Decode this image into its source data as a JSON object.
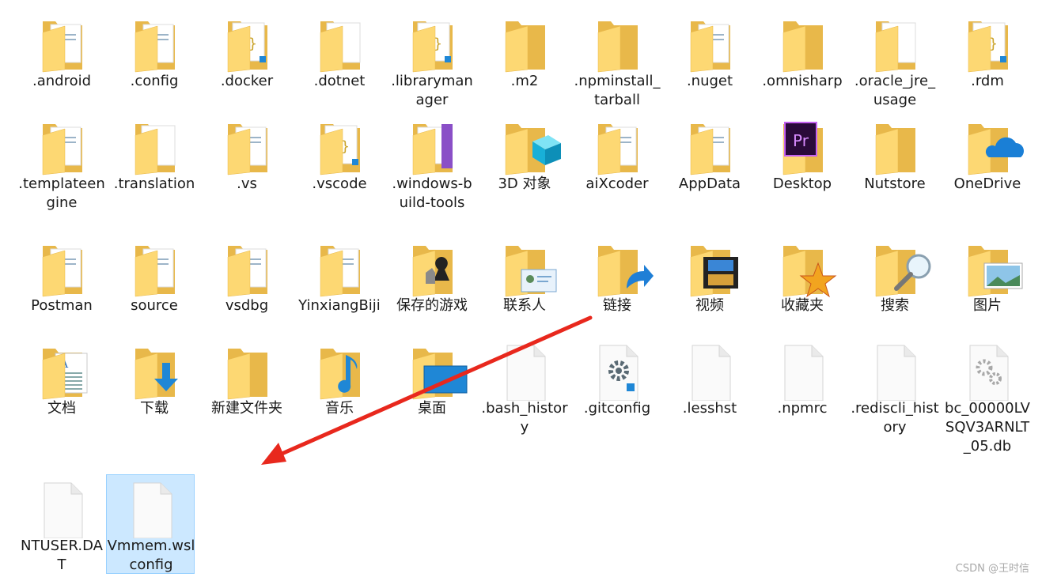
{
  "items": [
    {
      "label": ".android",
      "icon": "folder-android-icon",
      "kind": "folder",
      "overlay": "android"
    },
    {
      "label": ".config",
      "icon": "folder-icon",
      "kind": "folder",
      "overlay": "docs"
    },
    {
      "label": ".docker",
      "icon": "folder-json-icon",
      "kind": "folder",
      "overlay": "json"
    },
    {
      "label": ".dotnet",
      "icon": "folder-icon",
      "kind": "folder",
      "overlay": "blank"
    },
    {
      "label": ".librarymanager",
      "icon": "folder-json-icon",
      "kind": "folder",
      "overlay": "json"
    },
    {
      "label": ".m2",
      "icon": "folder-icon",
      "kind": "folder",
      "overlay": "none"
    },
    {
      "label": ".npminstall_tarball",
      "icon": "folder-icon",
      "kind": "folder",
      "overlay": "none"
    },
    {
      "label": ".nuget",
      "icon": "folder-icon",
      "kind": "folder",
      "overlay": "docs"
    },
    {
      "label": ".omnisharp",
      "icon": "folder-icon",
      "kind": "folder",
      "overlay": "none"
    },
    {
      "label": ".oracle_jre_usage",
      "icon": "folder-icon",
      "kind": "folder",
      "overlay": "blank"
    },
    {
      "label": ".rdm",
      "icon": "folder-json-icon",
      "kind": "folder",
      "overlay": "json"
    },
    {
      "label": ".templateengine",
      "icon": "folder-icon",
      "kind": "folder",
      "overlay": "docs"
    },
    {
      "label": ".translation",
      "icon": "folder-icon",
      "kind": "folder",
      "overlay": "blank"
    },
    {
      "label": ".vs",
      "icon": "folder-icon",
      "kind": "folder",
      "overlay": "docs"
    },
    {
      "label": ".vscode",
      "icon": "folder-json-icon",
      "kind": "folder",
      "overlay": "json"
    },
    {
      "label": ".windows-build-tools",
      "icon": "folder-vs-icon",
      "kind": "folder",
      "overlay": "vs"
    },
    {
      "label": "3D 对象",
      "icon": "folder-3d-objects-icon",
      "kind": "folder",
      "overlay": "cube"
    },
    {
      "label": "aiXcoder",
      "icon": "folder-icon",
      "kind": "folder",
      "overlay": "docs"
    },
    {
      "label": "AppData",
      "icon": "folder-icon",
      "kind": "folder",
      "overlay": "docs"
    },
    {
      "label": "Desktop",
      "icon": "folder-premiere-icon",
      "kind": "folder",
      "overlay": "pr"
    },
    {
      "label": "Nutstore",
      "icon": "folder-icon",
      "kind": "folder",
      "overlay": "none"
    },
    {
      "label": "OneDrive",
      "icon": "folder-onedrive-icon",
      "kind": "folder",
      "overlay": "cloud"
    },
    {
      "label": "Postman",
      "icon": "folder-icon",
      "kind": "folder",
      "overlay": "docs"
    },
    {
      "label": "source",
      "icon": "folder-icon",
      "kind": "folder",
      "overlay": "docs"
    },
    {
      "label": "vsdbg",
      "icon": "folder-icon",
      "kind": "folder",
      "overlay": "docs"
    },
    {
      "label": "YinxiangBiji",
      "icon": "folder-icon",
      "kind": "folder",
      "overlay": "docs"
    },
    {
      "label": "保存的游戏",
      "icon": "folder-saved-games-icon",
      "kind": "folder",
      "overlay": "chess"
    },
    {
      "label": "联系人",
      "icon": "folder-contacts-icon",
      "kind": "folder",
      "overlay": "contact"
    },
    {
      "label": "链接",
      "icon": "folder-links-icon",
      "kind": "folder",
      "overlay": "link"
    },
    {
      "label": "视频",
      "icon": "folder-videos-icon",
      "kind": "folder",
      "overlay": "film"
    },
    {
      "label": "收藏夹",
      "icon": "folder-favorites-icon",
      "kind": "folder",
      "overlay": "star"
    },
    {
      "label": "搜索",
      "icon": "folder-searches-icon",
      "kind": "folder",
      "overlay": "magnifier"
    },
    {
      "label": "图片",
      "icon": "folder-pictures-icon",
      "kind": "folder",
      "overlay": "picture"
    },
    {
      "label": "文档",
      "icon": "folder-documents-icon",
      "kind": "folder",
      "overlay": "doc"
    },
    {
      "label": "下载",
      "icon": "folder-downloads-icon",
      "kind": "folder",
      "overlay": "download"
    },
    {
      "label": "新建文件夹",
      "icon": "folder-icon",
      "kind": "folder",
      "overlay": "none"
    },
    {
      "label": "音乐",
      "icon": "folder-music-icon",
      "kind": "folder",
      "overlay": "music"
    },
    {
      "label": "桌面",
      "icon": "folder-desktop-icon",
      "kind": "folder",
      "overlay": "screen"
    },
    {
      "label": ".bash_history",
      "icon": "file-icon",
      "kind": "file",
      "overlay": "none"
    },
    {
      "label": ".gitconfig",
      "icon": "file-config-icon",
      "kind": "file",
      "overlay": "gear-vscode"
    },
    {
      "label": ".lesshst",
      "icon": "file-icon",
      "kind": "file",
      "overlay": "none"
    },
    {
      "label": ".npmrc",
      "icon": "file-icon",
      "kind": "file",
      "overlay": "none"
    },
    {
      "label": ".rediscli_history",
      "icon": "file-icon",
      "kind": "file",
      "overlay": "none"
    },
    {
      "label": "bc_00000LVSQV3ARNLT_05.db",
      "icon": "file-system-icon",
      "kind": "file",
      "overlay": "gears"
    },
    {
      "label": "NTUSER.DAT",
      "icon": "file-icon",
      "kind": "file",
      "overlay": "none"
    },
    {
      "label": "Vmmem.wslconfig",
      "icon": "file-icon",
      "kind": "file",
      "overlay": "none",
      "selected": true
    }
  ],
  "watermark": "CSDN @王时信",
  "colors": {
    "folder_back": "#e8b84a",
    "folder_front": "#fdd873",
    "selection_bg": "#cce8ff",
    "selection_border": "#99d1ff",
    "arrow": "#e8281d"
  }
}
